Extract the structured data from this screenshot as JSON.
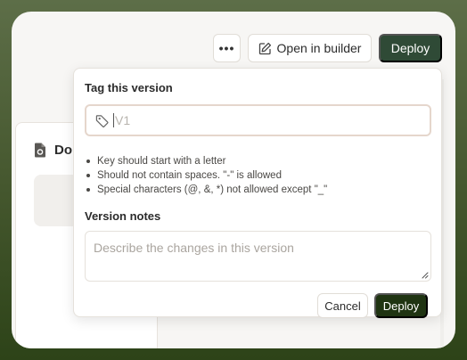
{
  "toolbar": {
    "more_label": "•••",
    "open_builder_label": "Open in builder",
    "deploy_label": "Deploy"
  },
  "background_card": {
    "title": "Do"
  },
  "popover": {
    "tag_label": "Tag this version",
    "tag_input_value": "",
    "tag_input_placeholder": "V1",
    "rules": [
      "Key should start with a letter",
      "Should not contain spaces. \"-\" is allowed",
      "Special characters (@, &, *) not allowed except \"_\""
    ],
    "notes_label": "Version notes",
    "notes_placeholder": "Describe the changes in this version",
    "cancel_label": "Cancel",
    "deploy_label": "Deploy"
  },
  "colors": {
    "primary_green": "#2f4a36",
    "deploy_dark": "#1f3412",
    "frame_gradient_top": "#5d6e48",
    "frame_gradient_bottom": "#2d4318"
  },
  "icons": {
    "more": "more-horizontal-icon",
    "builder": "edit-square-icon",
    "tag": "tag-icon",
    "document": "document-icon",
    "resize": "resize-grip-icon"
  }
}
